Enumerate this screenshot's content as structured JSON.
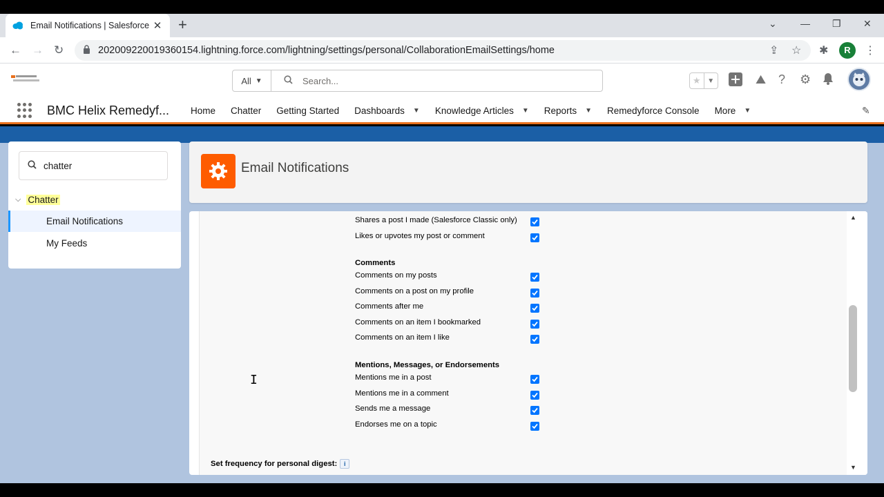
{
  "browser": {
    "tab_title": "Email Notifications | Salesforce",
    "url": "202009220019360154.lightning.force.com/lightning/settings/personal/CollaborationEmailSettings/home",
    "profile_initial": "R"
  },
  "header": {
    "search_scope": "All",
    "search_placeholder": "Search..."
  },
  "appnav": {
    "app_name": "BMC Helix Remedyf...",
    "items": [
      {
        "label": "Home",
        "dropdown": false
      },
      {
        "label": "Chatter",
        "dropdown": false
      },
      {
        "label": "Getting Started",
        "dropdown": false
      },
      {
        "label": "Dashboards",
        "dropdown": true
      },
      {
        "label": "Knowledge Articles",
        "dropdown": true
      },
      {
        "label": "Reports",
        "dropdown": true
      },
      {
        "label": "Remedyforce Console",
        "dropdown": false
      },
      {
        "label": "More",
        "dropdown": true
      }
    ]
  },
  "sidebar": {
    "quick_find": "chatter",
    "root": "Chatter",
    "items": [
      {
        "label": "Email Notifications",
        "selected": true
      },
      {
        "label": "My Feeds",
        "selected": false
      }
    ]
  },
  "page": {
    "title": "Email Notifications"
  },
  "settings": {
    "top_rows": [
      {
        "label": "Shares a post I made (Salesforce Classic only)",
        "checked": true
      },
      {
        "label": "Likes or upvotes my post or comment",
        "checked": true
      }
    ],
    "comments_heading": "Comments",
    "comments": [
      {
        "label": "Comments on my posts",
        "checked": true
      },
      {
        "label": "Comments on a post on my profile",
        "checked": true
      },
      {
        "label": "Comments after me",
        "checked": true
      },
      {
        "label": "Comments on an item I bookmarked",
        "checked": true
      },
      {
        "label": "Comments on an item I like",
        "checked": true
      }
    ],
    "mentions_heading": "Mentions, Messages, or Endorsements",
    "mentions": [
      {
        "label": "Mentions me in a post",
        "checked": true
      },
      {
        "label": "Mentions me in a comment",
        "checked": true
      },
      {
        "label": "Sends me a message",
        "checked": true
      },
      {
        "label": "Endorses me on a topic",
        "checked": true
      }
    ],
    "digest_label": "Set frequency for personal digest:",
    "info_glyph": "i"
  },
  "colors": {
    "accent_orange": "#fe5c00",
    "nav_underline": "#e8701d",
    "checkbox_blue": "#0075ff"
  }
}
